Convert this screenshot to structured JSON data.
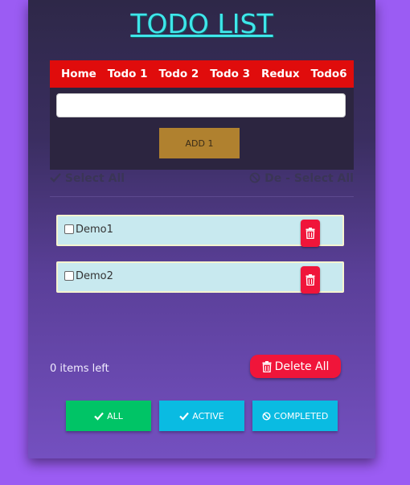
{
  "app": {
    "title": "TODO LIST"
  },
  "nav": {
    "items": [
      "Home",
      "Todo 1",
      "Todo 2",
      "Todo 3",
      "Redux",
      "Todo6"
    ]
  },
  "input": {
    "value": "",
    "placeholder": ""
  },
  "add_button": {
    "label": "ADD 1"
  },
  "select": {
    "select_all": "Select All",
    "deselect_all": "De - Select All"
  },
  "todos": [
    {
      "text": "Demo1",
      "checked": false
    },
    {
      "text": "Demo2",
      "checked": false
    }
  ],
  "footer": {
    "items_left": "0 items left",
    "delete_all": "Delete All"
  },
  "filters": {
    "all": "ALL",
    "active": "ACTIVE",
    "completed": "COMPLETED"
  },
  "colors": {
    "background": "#9b5cf3",
    "title": "#3fe6ea",
    "navbar": "#e00c0c",
    "add_button": "#b0812f",
    "delete": "#f0153a",
    "filter_all": "#00c466",
    "filter_other": "#0abbe2"
  },
  "icons": [
    "check-icon",
    "ban-icon",
    "trash-icon"
  ]
}
